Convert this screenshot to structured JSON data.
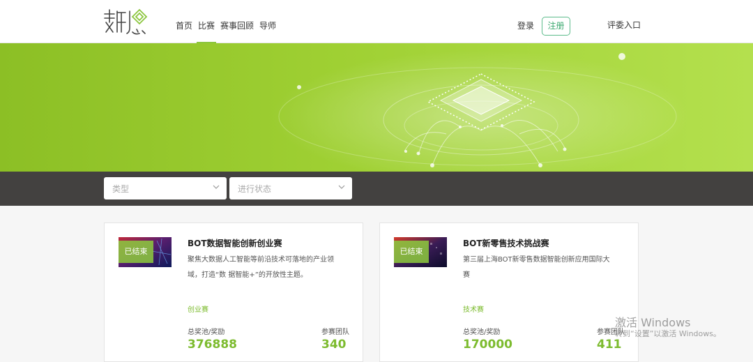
{
  "header": {
    "logo_text": "数愿",
    "nav": [
      {
        "label": "首页",
        "active": false
      },
      {
        "label": "比赛",
        "active": true
      },
      {
        "label": "赛事回顾",
        "active": false
      },
      {
        "label": "导师",
        "active": false
      }
    ],
    "login": "登录",
    "register": "注册",
    "judge_entry": "评委入口"
  },
  "filters": {
    "type_placeholder": "类型",
    "status_placeholder": "进行状态"
  },
  "cards": [
    {
      "status": "已结束",
      "title": "BOT数据智能创新创业赛",
      "desc_line1": "聚焦大数据人工智能等前沿技术可落地的产业领",
      "desc_line2": "域，打造“数 据智能+”的开放性主题。",
      "tag": "创业赛",
      "prize_label": "总奖池/奖励",
      "prize_value": "376888",
      "team_label": "参赛团队",
      "team_value": "340"
    },
    {
      "status": "已结束",
      "title": "BOT新零售技术挑战赛",
      "desc_line1": "第三届上海BOT新零售数据智能创新应用国际大",
      "desc_line2": "赛",
      "tag": "技术赛",
      "prize_label": "总奖池/奖励",
      "prize_value": "170000",
      "team_label": "参赛团队",
      "team_value": "411"
    }
  ],
  "watermark": {
    "title": "激活 Windows",
    "subtitle": "转到“设置”以激活 Windows。"
  },
  "colors": {
    "accent": "#8cc63f",
    "banner_start": "#8cbf25",
    "banner_end": "#b4e04e",
    "filter_bar": "#434140"
  }
}
